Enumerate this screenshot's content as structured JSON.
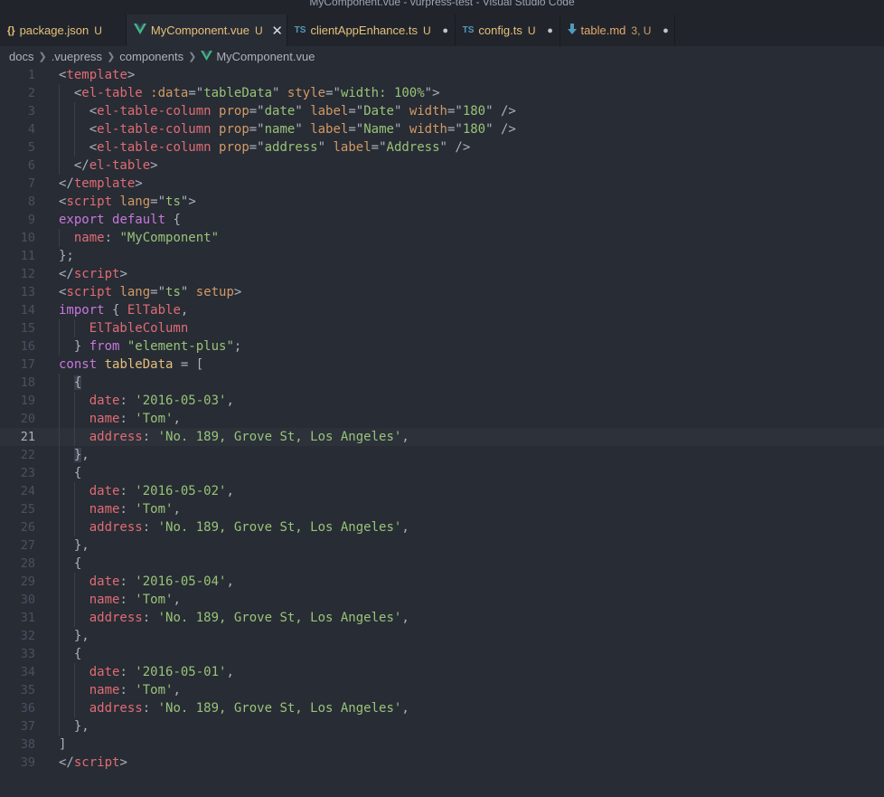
{
  "window": {
    "title": "MyComponent.vue - vurpress-test - Visual Studio Code"
  },
  "tabs": [
    {
      "label": "package.json",
      "icon": "{}",
      "status": "U",
      "end": ""
    },
    {
      "label": "MyComponent.vue",
      "icon": "vue-icon",
      "status": "U",
      "end": "✕",
      "active": true
    },
    {
      "label": "clientAppEnhance.ts",
      "icon": "TS",
      "status": "U",
      "end": "●"
    },
    {
      "label": "config.ts",
      "icon": "TS",
      "status": "U",
      "end": "●"
    },
    {
      "label": "table.md",
      "icon": "md-icon",
      "status": "3, U",
      "end": "●"
    }
  ],
  "breadcrumb": [
    "docs",
    ".vuepress",
    "components",
    "MyComponent.vue"
  ],
  "editor": {
    "current_line": 21,
    "lines": [
      [
        [
          1,
          "<"
        ],
        [
          0,
          "template"
        ],
        [
          1,
          ">"
        ]
      ],
      [
        [
          8,
          "  "
        ],
        [
          1,
          "<"
        ],
        [
          0,
          "el-table"
        ],
        [
          9,
          " "
        ],
        [
          2,
          ":data"
        ],
        [
          1,
          "=\""
        ],
        [
          3,
          "tableData"
        ],
        [
          1,
          "\""
        ],
        [
          9,
          " "
        ],
        [
          2,
          "style"
        ],
        [
          1,
          "=\""
        ],
        [
          3,
          "width: 100%"
        ],
        [
          1,
          "\">"
        ]
      ],
      [
        [
          8,
          "    "
        ],
        [
          1,
          "<"
        ],
        [
          0,
          "el-table-column"
        ],
        [
          9,
          " "
        ],
        [
          2,
          "prop"
        ],
        [
          1,
          "=\""
        ],
        [
          3,
          "date"
        ],
        [
          1,
          "\""
        ],
        [
          9,
          " "
        ],
        [
          2,
          "label"
        ],
        [
          1,
          "=\""
        ],
        [
          3,
          "Date"
        ],
        [
          1,
          "\""
        ],
        [
          9,
          " "
        ],
        [
          2,
          "width"
        ],
        [
          1,
          "=\""
        ],
        [
          3,
          "180"
        ],
        [
          1,
          "\""
        ],
        [
          9,
          " "
        ],
        [
          1,
          "/>"
        ]
      ],
      [
        [
          8,
          "    "
        ],
        [
          1,
          "<"
        ],
        [
          0,
          "el-table-column"
        ],
        [
          9,
          " "
        ],
        [
          2,
          "prop"
        ],
        [
          1,
          "=\""
        ],
        [
          3,
          "name"
        ],
        [
          1,
          "\""
        ],
        [
          9,
          " "
        ],
        [
          2,
          "label"
        ],
        [
          1,
          "=\""
        ],
        [
          3,
          "Name"
        ],
        [
          1,
          "\""
        ],
        [
          9,
          " "
        ],
        [
          2,
          "width"
        ],
        [
          1,
          "=\""
        ],
        [
          3,
          "180"
        ],
        [
          1,
          "\""
        ],
        [
          9,
          " "
        ],
        [
          1,
          "/>"
        ]
      ],
      [
        [
          8,
          "    "
        ],
        [
          1,
          "<"
        ],
        [
          0,
          "el-table-column"
        ],
        [
          9,
          " "
        ],
        [
          2,
          "prop"
        ],
        [
          1,
          "=\""
        ],
        [
          3,
          "address"
        ],
        [
          1,
          "\""
        ],
        [
          9,
          " "
        ],
        [
          2,
          "label"
        ],
        [
          1,
          "=\""
        ],
        [
          3,
          "Address"
        ],
        [
          1,
          "\""
        ],
        [
          9,
          " "
        ],
        [
          1,
          "/>"
        ]
      ],
      [
        [
          8,
          "  "
        ],
        [
          1,
          "</"
        ],
        [
          0,
          "el-table"
        ],
        [
          1,
          ">"
        ]
      ],
      [
        [
          1,
          "</"
        ],
        [
          0,
          "template"
        ],
        [
          1,
          ">"
        ]
      ],
      [
        [
          1,
          "<"
        ],
        [
          0,
          "script"
        ],
        [
          9,
          " "
        ],
        [
          2,
          "lang"
        ],
        [
          1,
          "=\""
        ],
        [
          3,
          "ts"
        ],
        [
          1,
          "\">"
        ]
      ],
      [
        [
          4,
          "export"
        ],
        [
          9,
          " "
        ],
        [
          4,
          "default"
        ],
        [
          9,
          " "
        ],
        [
          1,
          "{"
        ]
      ],
      [
        [
          8,
          "  "
        ],
        [
          5,
          "name"
        ],
        [
          1,
          ": "
        ],
        [
          3,
          "\"MyComponent\""
        ]
      ],
      [
        [
          1,
          "};"
        ]
      ],
      [
        [
          1,
          "</"
        ],
        [
          0,
          "script"
        ],
        [
          1,
          ">"
        ]
      ],
      [
        [
          1,
          "<"
        ],
        [
          0,
          "script"
        ],
        [
          9,
          " "
        ],
        [
          2,
          "lang"
        ],
        [
          1,
          "=\""
        ],
        [
          3,
          "ts"
        ],
        [
          1,
          "\""
        ],
        [
          9,
          " "
        ],
        [
          2,
          "setup"
        ],
        [
          1,
          ">"
        ]
      ],
      [
        [
          4,
          "import"
        ],
        [
          9,
          " "
        ],
        [
          1,
          "{ "
        ],
        [
          5,
          "ElTable"
        ],
        [
          1,
          ","
        ]
      ],
      [
        [
          8,
          "    "
        ],
        [
          5,
          "ElTableColumn"
        ]
      ],
      [
        [
          8,
          "  "
        ],
        [
          1,
          "} "
        ],
        [
          4,
          "from"
        ],
        [
          9,
          " "
        ],
        [
          3,
          "\"element-plus\""
        ],
        [
          1,
          ";"
        ]
      ],
      [
        [
          4,
          "const"
        ],
        [
          9,
          " "
        ],
        [
          6,
          "tableData"
        ],
        [
          9,
          " "
        ],
        [
          1,
          "= ["
        ]
      ],
      [
        [
          8,
          "  "
        ],
        [
          7,
          "{"
        ]
      ],
      [
        [
          8,
          "    "
        ],
        [
          5,
          "date"
        ],
        [
          1,
          ": "
        ],
        [
          3,
          "'2016-05-03'"
        ],
        [
          1,
          ","
        ]
      ],
      [
        [
          8,
          "    "
        ],
        [
          5,
          "name"
        ],
        [
          1,
          ": "
        ],
        [
          3,
          "'Tom'"
        ],
        [
          1,
          ","
        ]
      ],
      [
        [
          8,
          "    "
        ],
        [
          5,
          "address"
        ],
        [
          1,
          ": "
        ],
        [
          3,
          "'No. 189, Grove St, Los Angeles'"
        ],
        [
          1,
          ","
        ]
      ],
      [
        [
          8,
          "  "
        ],
        [
          7,
          "}"
        ],
        [
          1,
          ","
        ]
      ],
      [
        [
          8,
          "  "
        ],
        [
          1,
          "{"
        ]
      ],
      [
        [
          8,
          "    "
        ],
        [
          5,
          "date"
        ],
        [
          1,
          ": "
        ],
        [
          3,
          "'2016-05-02'"
        ],
        [
          1,
          ","
        ]
      ],
      [
        [
          8,
          "    "
        ],
        [
          5,
          "name"
        ],
        [
          1,
          ": "
        ],
        [
          3,
          "'Tom'"
        ],
        [
          1,
          ","
        ]
      ],
      [
        [
          8,
          "    "
        ],
        [
          5,
          "address"
        ],
        [
          1,
          ": "
        ],
        [
          3,
          "'No. 189, Grove St, Los Angeles'"
        ],
        [
          1,
          ","
        ]
      ],
      [
        [
          8,
          "  "
        ],
        [
          1,
          "},"
        ]
      ],
      [
        [
          8,
          "  "
        ],
        [
          1,
          "{"
        ]
      ],
      [
        [
          8,
          "    "
        ],
        [
          5,
          "date"
        ],
        [
          1,
          ": "
        ],
        [
          3,
          "'2016-05-04'"
        ],
        [
          1,
          ","
        ]
      ],
      [
        [
          8,
          "    "
        ],
        [
          5,
          "name"
        ],
        [
          1,
          ": "
        ],
        [
          3,
          "'Tom'"
        ],
        [
          1,
          ","
        ]
      ],
      [
        [
          8,
          "    "
        ],
        [
          5,
          "address"
        ],
        [
          1,
          ": "
        ],
        [
          3,
          "'No. 189, Grove St, Los Angeles'"
        ],
        [
          1,
          ","
        ]
      ],
      [
        [
          8,
          "  "
        ],
        [
          1,
          "},"
        ]
      ],
      [
        [
          8,
          "  "
        ],
        [
          1,
          "{"
        ]
      ],
      [
        [
          8,
          "    "
        ],
        [
          5,
          "date"
        ],
        [
          1,
          ": "
        ],
        [
          3,
          "'2016-05-01'"
        ],
        [
          1,
          ","
        ]
      ],
      [
        [
          8,
          "    "
        ],
        [
          5,
          "name"
        ],
        [
          1,
          ": "
        ],
        [
          3,
          "'Tom'"
        ],
        [
          1,
          ","
        ]
      ],
      [
        [
          8,
          "    "
        ],
        [
          5,
          "address"
        ],
        [
          1,
          ": "
        ],
        [
          3,
          "'No. 189, Grove St, Los Angeles'"
        ],
        [
          1,
          ","
        ]
      ],
      [
        [
          8,
          "  "
        ],
        [
          1,
          "},"
        ]
      ],
      [
        [
          1,
          "]"
        ]
      ],
      [
        [
          1,
          "</"
        ],
        [
          0,
          "script"
        ],
        [
          1,
          ">"
        ]
      ]
    ]
  },
  "colors": {
    "background": "#282c34",
    "tag": "#e06c75",
    "attribute": "#d19a66",
    "string": "#98c379",
    "keyword": "#c678dd",
    "vue": "#41b883"
  }
}
